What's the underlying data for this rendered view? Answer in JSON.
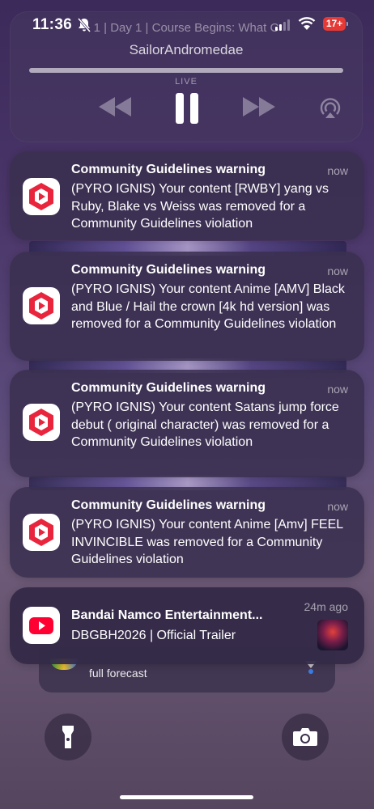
{
  "status_bar": {
    "time": "11:36",
    "battery": "17+"
  },
  "player": {
    "title": "1 | Day 1 | Course Begins: What C",
    "artist": "SailorAndromedae",
    "live_label": "LIVE"
  },
  "notifications": [
    {
      "title": "Community Guidelines warning",
      "time": "now",
      "body": "(PYRO IGNIS) Your content [RWBY] yang vs Ruby, Blake vs Weiss was removed for a Community Guidelines violation"
    },
    {
      "title": "Community Guidelines warning",
      "time": "now",
      "body": "(PYRO IGNIS) Your content Anime [AMV] Black and Blue / Hail the crown [4k hd version] was removed for a Community Guidelines violation"
    },
    {
      "title": "Community Guidelines warning",
      "time": "now",
      "body": "(PYRO IGNIS) Your content Satans jump force  debut ( original character) was removed for a Community Guidelines violation"
    },
    {
      "title": "Community Guidelines warning",
      "time": "now",
      "body": "(PYRO IGNIS) Your content Anime [Amv] FEEL INVINCIBLE was removed for a Community Guidelines violation"
    },
    {
      "title": "Bandai Namco Entertainment...",
      "time": "24m ago",
      "body": "DBGBH2026 | Official Trailer"
    }
  ],
  "weather": {
    "text": "full forecast"
  },
  "colors": {
    "youtube_red": "#ff0033",
    "studio_red": "#e8253d",
    "battery_red": "#e53936"
  },
  "icons": [
    "bell-slash-icon",
    "wifi-icon",
    "rewind-icon",
    "pause-icon",
    "forward-icon",
    "airplay-icon",
    "youtube-studio-icon",
    "youtube-icon",
    "flashlight-icon",
    "camera-icon"
  ]
}
